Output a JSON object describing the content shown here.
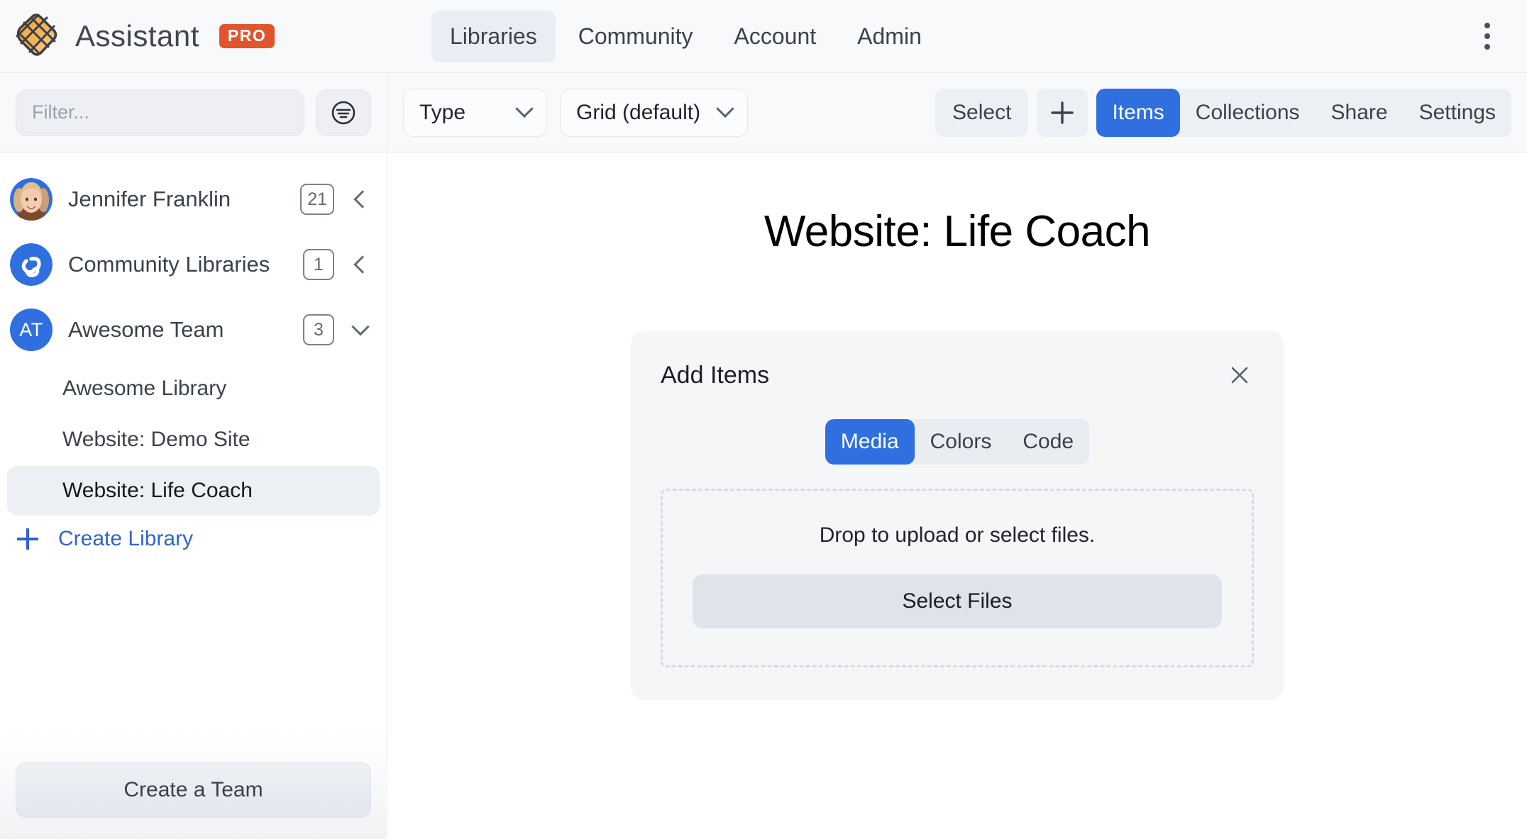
{
  "brand": {
    "name": "Assistant",
    "badge": "PRO",
    "logo_icon": "assistant-logo-icon"
  },
  "nav": {
    "items": [
      {
        "label": "Libraries",
        "active": true
      },
      {
        "label": "Community",
        "active": false
      },
      {
        "label": "Account",
        "active": false
      },
      {
        "label": "Admin",
        "active": false
      }
    ],
    "overflow_icon": "kebab-menu-icon"
  },
  "toolbar": {
    "filter_placeholder": "Filter...",
    "filter_value": "",
    "filter_options_icon": "filter-options-icon",
    "type_dropdown": "Type",
    "view_dropdown": "Grid (default)",
    "select_label": "Select",
    "add_icon": "plus-icon",
    "tabs": [
      {
        "label": "Items",
        "active": true
      },
      {
        "label": "Collections",
        "active": false
      },
      {
        "label": "Share",
        "active": false
      },
      {
        "label": "Settings",
        "active": false
      }
    ]
  },
  "sidebar": {
    "teams": [
      {
        "name": "Jennifer Franklin",
        "count": "21",
        "avatar_type": "photo",
        "initials": "",
        "expanded": false
      },
      {
        "name": "Community Libraries",
        "count": "1",
        "avatar_type": "swirl",
        "initials": "",
        "expanded": false
      },
      {
        "name": "Awesome Team",
        "count": "3",
        "avatar_type": "initials",
        "initials": "AT",
        "expanded": true
      }
    ],
    "libraries": [
      {
        "label": "Awesome Library",
        "active": false
      },
      {
        "label": "Website: Demo Site",
        "active": false
      },
      {
        "label": "Website: Life Coach",
        "active": true
      }
    ],
    "create_library_label": "Create Library",
    "create_team_label": "Create a Team"
  },
  "main": {
    "page_title": "Website: Life Coach",
    "panel": {
      "title": "Add Items",
      "close_icon": "close-icon",
      "tabs": [
        {
          "label": "Media",
          "active": true
        },
        {
          "label": "Colors",
          "active": false
        },
        {
          "label": "Code",
          "active": false
        }
      ],
      "dropzone_text": "Drop to upload or select files.",
      "select_files_label": "Select Files"
    }
  },
  "colors": {
    "accent_blue": "#2f6fe0",
    "pro_orange": "#e0552d",
    "link_blue": "#2f63cf",
    "toolbar_bg": "#f8f9fa",
    "panel_bg": "#f5f6f8"
  }
}
